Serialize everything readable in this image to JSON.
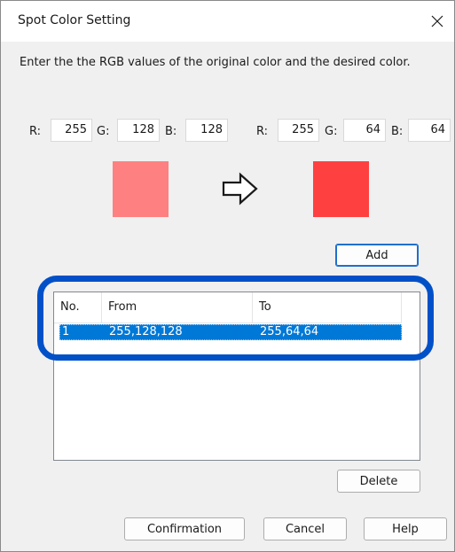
{
  "window": {
    "title": "Spot Color Setting"
  },
  "instruction": "Enter the the RGB values of the original color and the desired color.",
  "original": {
    "r_label": "R:",
    "g_label": "G:",
    "b_label": "B:",
    "r": "255",
    "g": "128",
    "b": "128",
    "swatch_color": "#ff8080"
  },
  "desired": {
    "r_label": "R:",
    "g_label": "G:",
    "b_label": "B:",
    "r": "255",
    "g": "64",
    "b": "64",
    "swatch_color": "#ff4040"
  },
  "buttons": {
    "add": "Add",
    "delete": "Delete",
    "confirmation": "Confirmation",
    "cancel": "Cancel",
    "help": "Help"
  },
  "list": {
    "columns": [
      "No.",
      "From",
      "To"
    ],
    "rows": [
      {
        "no": "1",
        "from": "255,128,128",
        "to": "255,64,64",
        "selected": true
      }
    ]
  },
  "colors": {
    "selection": "#0078d7",
    "highlight_ring": "#0050c8"
  }
}
